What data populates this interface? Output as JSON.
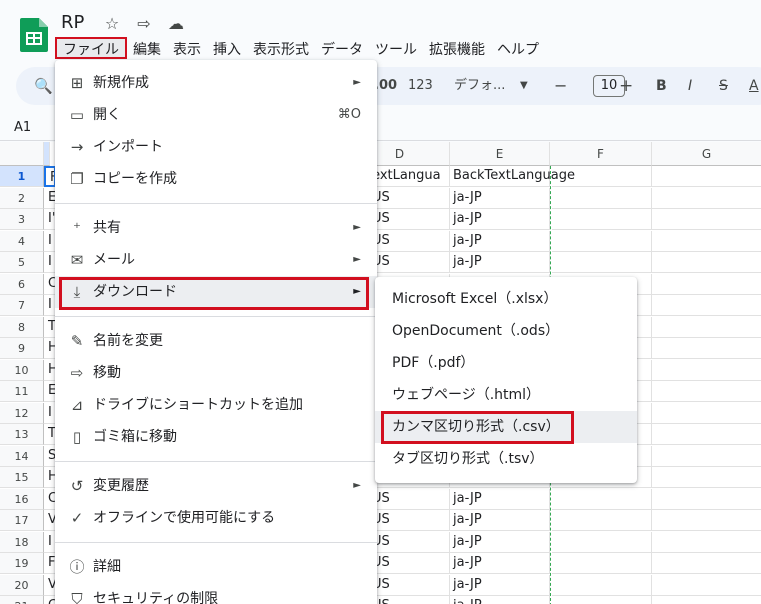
{
  "doc": {
    "title": "RP"
  },
  "menubar": [
    "ファイル",
    "編集",
    "表示",
    "挿入",
    "表示形式",
    "データ",
    "ツール",
    "拡張機能",
    "ヘルプ"
  ],
  "toolbar": {
    "decimal_more": ".00",
    "number_format": "123",
    "font": "デフォ...",
    "font_size": "10",
    "minus": "−",
    "plus": "+",
    "bold": "B",
    "italic": "I",
    "strike": "S",
    "text_color": "A"
  },
  "name_box": "A1",
  "columns": [
    "D",
    "E",
    "F",
    "G"
  ],
  "rows": [
    "1",
    "2",
    "3",
    "4",
    "5",
    "6",
    "7",
    "8",
    "9",
    "10",
    "11",
    "12",
    "13",
    "14",
    "15",
    "16",
    "17",
    "18",
    "19",
    "20",
    "21"
  ],
  "col_a_initials": [
    "F",
    "E",
    "I'",
    "I",
    "I",
    "C",
    "I",
    "T",
    "H",
    "H",
    "E",
    "I",
    "T",
    "S",
    "H",
    "C",
    "V",
    "I",
    "F",
    "V",
    "C"
  ],
  "cells": {
    "D1": "ntTextLangua",
    "E1": "BackTextLanguage",
    "D_rows": [
      "US",
      "US",
      "US",
      "US",
      "",
      "",
      "",
      "",
      "",
      "",
      "",
      "",
      "",
      "",
      "US",
      "US",
      "US",
      "US",
      "US",
      "US"
    ],
    "E_rows": [
      "ja-JP",
      "ja-JP",
      "ja-JP",
      "ja-JP",
      "",
      "",
      "",
      "",
      "",
      "",
      "",
      "",
      "",
      "",
      "ja-JP",
      "ja-JP",
      "ja-JP",
      "ja-JP",
      "ja-JP",
      "ja-JP"
    ]
  },
  "file_menu": {
    "items": [
      {
        "icon": "new-icon",
        "label": "新規作成",
        "arrow": "►"
      },
      {
        "icon": "open-icon",
        "label": "開く",
        "shortcut": "⌘O"
      },
      {
        "icon": "import-icon",
        "label": "インポート"
      },
      {
        "icon": "copy-icon",
        "label": "コピーを作成"
      },
      {
        "icon": "share-icon",
        "label": "共有",
        "arrow": "►"
      },
      {
        "icon": "mail-icon",
        "label": "メール",
        "arrow": "►"
      },
      {
        "icon": "download-icon",
        "label": "ダウンロード",
        "arrow": "►"
      },
      {
        "icon": "rename-icon",
        "label": "名前を変更"
      },
      {
        "icon": "move-icon",
        "label": "移動"
      },
      {
        "icon": "drive-shortcut-icon",
        "label": "ドライブにショートカットを追加"
      },
      {
        "icon": "trash-icon",
        "label": "ゴミ箱に移動"
      },
      {
        "icon": "history-icon",
        "label": "変更履歴",
        "arrow": "►"
      },
      {
        "icon": "offline-icon",
        "label": "オフラインで使用可能にする"
      },
      {
        "icon": "info-icon",
        "label": "詳細"
      },
      {
        "icon": "security-icon",
        "label": "セキュリティの制限"
      }
    ]
  },
  "download_menu": {
    "items": [
      "Microsoft Excel（.xlsx）",
      "OpenDocument（.ods）",
      "PDF（.pdf）",
      "ウェブページ（.html）",
      "カンマ区切り形式（.csv）",
      "タブ区切り形式（.tsv）"
    ]
  },
  "colors": {
    "highlight_red": "#d20f1f",
    "accent_green": "#34a853",
    "menu_hover": "#eceef1"
  }
}
